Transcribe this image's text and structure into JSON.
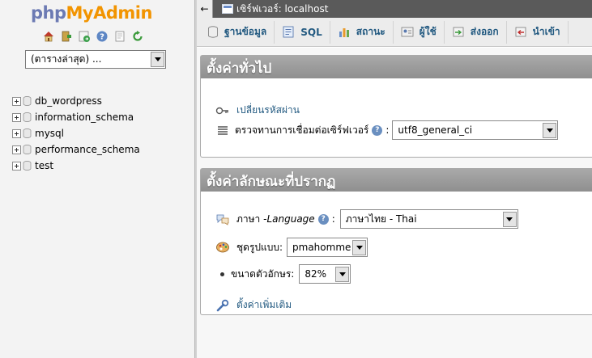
{
  "logo": {
    "php": "php",
    "my_admin": "MyAdmin"
  },
  "nav": {
    "icons": [
      "home-icon",
      "exit-icon",
      "sql-query-icon",
      "help-icon",
      "docs-icon",
      "reload-icon"
    ],
    "database_select": {
      "value": "(ตารางล่าสุด) ..."
    },
    "databases": [
      "db_wordpress",
      "information_schema",
      "mysql",
      "performance_schema",
      "test"
    ]
  },
  "topbar": {
    "back": "←",
    "breadcrumb": "เซิร์ฟเวอร์: localhost"
  },
  "tabs": [
    {
      "label": "ฐานข้อมูล",
      "icon": "database-icon"
    },
    {
      "label": "SQL",
      "icon": "sql-icon"
    },
    {
      "label": "สถานะ",
      "icon": "status-icon"
    },
    {
      "label": "ผู้ใช้",
      "icon": "users-icon"
    },
    {
      "label": "ส่งออก",
      "icon": "export-icon"
    },
    {
      "label": "นำเข้า",
      "icon": "import-icon"
    }
  ],
  "general": {
    "title": "ตั้งค่าทั่วไป",
    "change_password": "เปลี่ยนรหัสผ่าน",
    "collation_label": "ตรวจทานการเชื่อมต่อเซิร์ฟเวอร์",
    "collation_value": "utf8_general_ci"
  },
  "appearance": {
    "title": "ตั้งค่าลักษณะที่ปรากฏ",
    "language_label_th": "ภาษา - ",
    "language_label_en": "Language",
    "language_value": "ภาษาไทย - Thai",
    "theme_label": "ชุดรูปแบบ:",
    "theme_value": "pmahomme",
    "font_size_label": "ขนาดตัวอักษร:",
    "font_size_value": "82%",
    "more_settings": "ตั้งค่าเพิ่มเติม"
  },
  "colors": {
    "link": "#235a81",
    "logo_php": "#6c7ab3",
    "logo_admin": "#f29400",
    "panel_header": "#9b9b9b"
  }
}
